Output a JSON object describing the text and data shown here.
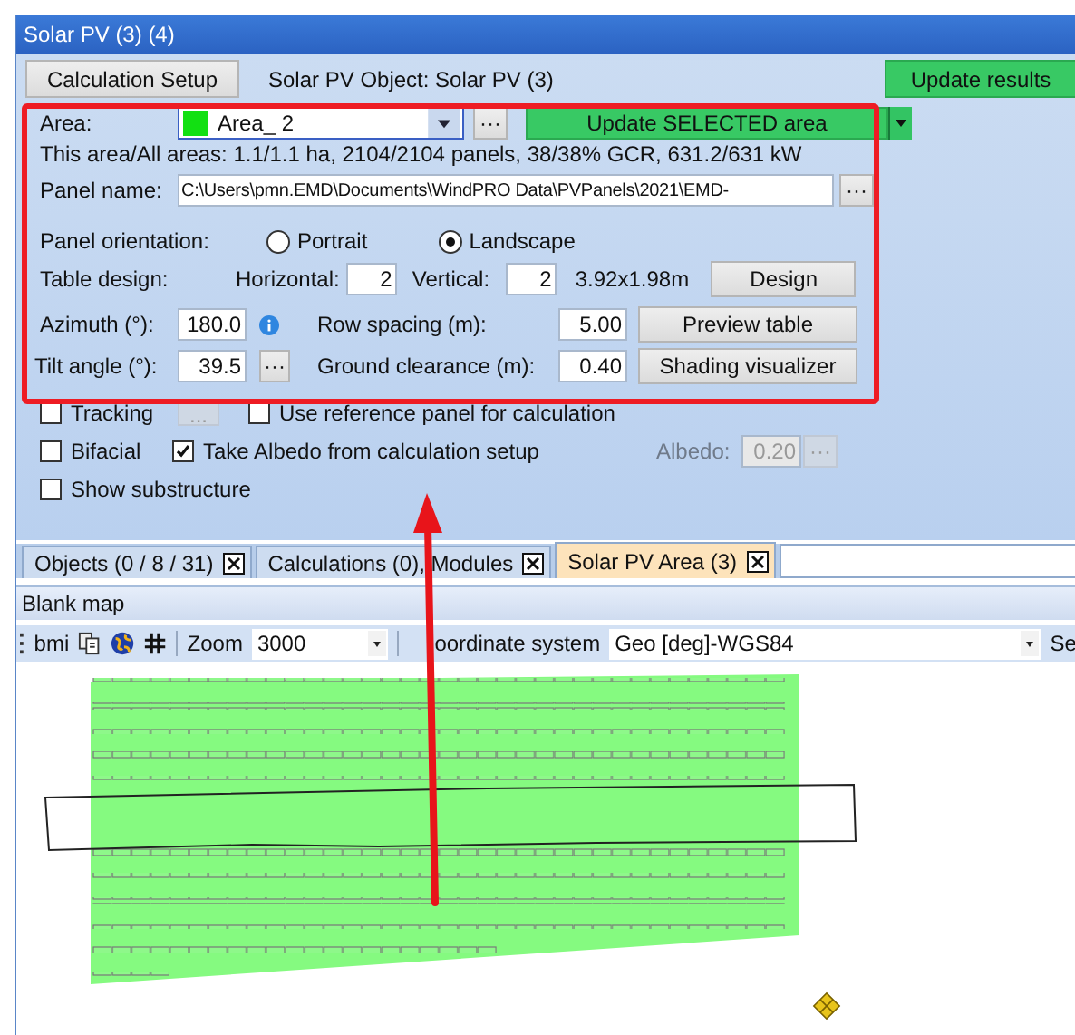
{
  "window": {
    "title": "Solar PV (3) (4)"
  },
  "header": {
    "setup_button": "Calculation Setup",
    "object_label": "Solar PV Object: Solar PV (3)",
    "update_button": "Update results"
  },
  "area": {
    "label": "Area:",
    "value": "Area_ 2",
    "more_button": "···",
    "update_button": "Update SELECTED area",
    "summary": "This area/All areas: 1.1/1.1 ha, 2104/2104 panels, 38/38% GCR, 631.2/631 kW"
  },
  "panel_name": {
    "label": "Panel name:",
    "value": "C:\\Users\\pmn.EMD\\Documents\\WindPRO Data\\PVPanels\\2021\\EMD-",
    "more_button": "···"
  },
  "orientation": {
    "label": "Panel orientation:",
    "options": [
      {
        "label": "Portrait",
        "selected": false
      },
      {
        "label": "Landscape",
        "selected": true
      }
    ]
  },
  "table_design": {
    "label": "Table design:",
    "horizontal_label": "Horizontal:",
    "horizontal": "2",
    "vertical_label": "Vertical:",
    "vertical": "2",
    "size": "3.92x1.98m",
    "design_button": "Design"
  },
  "azimuth": {
    "label": "Azimuth (°):",
    "value": "180.0"
  },
  "row_spacing": {
    "label": "Row spacing (m):",
    "value": "5.00",
    "button": "Preview table"
  },
  "tilt": {
    "label": "Tilt angle (°):",
    "value": "39.5",
    "more_button": "···"
  },
  "ground_clearance": {
    "label": "Ground clearance (m):",
    "value": "0.40",
    "button": "Shading visualizer"
  },
  "tracking": {
    "label": "Tracking",
    "checked": false,
    "more_button": "...",
    "more_disabled": true
  },
  "reference_panel": {
    "label": "Use reference panel for calculation",
    "checked": false
  },
  "bifacial": {
    "label": "Bifacial",
    "checked": false
  },
  "albedo_from_setup": {
    "label": "Take Albedo from calculation setup",
    "checked": true
  },
  "albedo": {
    "label": "Albedo:",
    "value": "0.20",
    "disabled": true,
    "more_button": "···"
  },
  "substructure": {
    "label": "Show substructure",
    "checked": false
  },
  "tabs": [
    {
      "label": "Objects (0 / 8 / 31)",
      "selected": false
    },
    {
      "label": "Calculations (0), Modules",
      "selected": false
    },
    {
      "label": "Solar PV Area (3)",
      "selected": true
    }
  ],
  "map_title": "Blank map",
  "toolbar": {
    "bmi": "bmi",
    "zoom_label": "Zoom",
    "zoom": "3000",
    "coordinate_label": "oordinate system",
    "coordinate": "Geo [deg]-WGS84",
    "cut_label": "Se"
  }
}
